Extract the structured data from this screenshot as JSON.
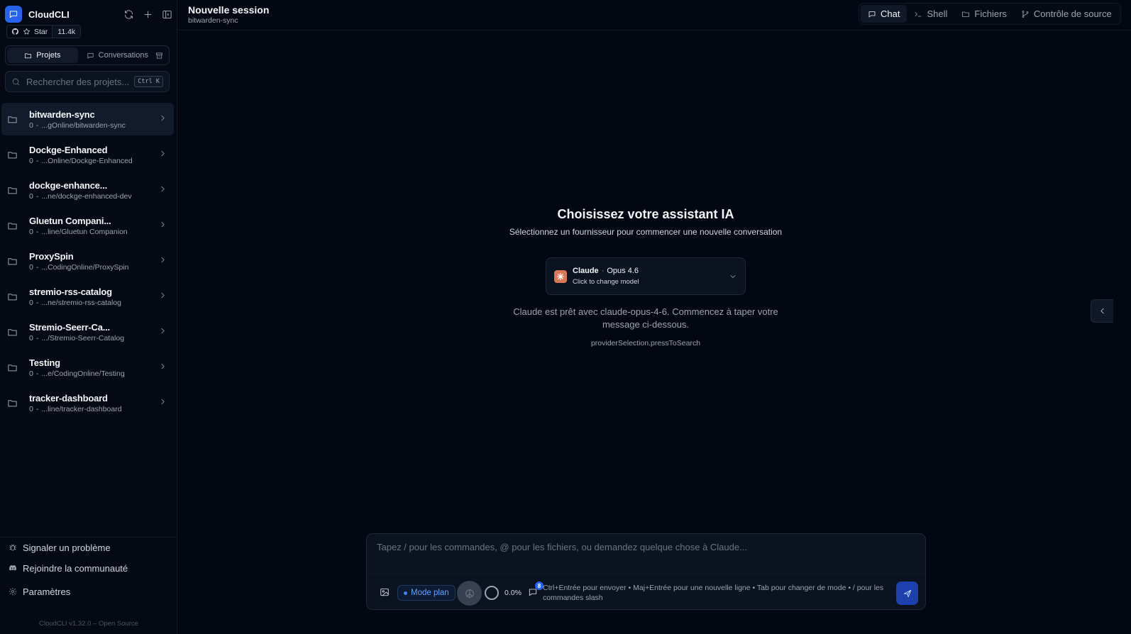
{
  "app": {
    "name": "CloudCLI",
    "version": "CloudCLI v1.32.0 – Open Source"
  },
  "github": {
    "star_label": "Star",
    "star_count": "11.4k"
  },
  "sidebar": {
    "tabs": [
      {
        "label": "Projets"
      },
      {
        "label": "Conversations"
      }
    ],
    "search": {
      "placeholder": "Rechercher des projets...",
      "shortcut": "Ctrl K"
    },
    "projects": [
      {
        "name": "bitwarden-sync",
        "count": "0",
        "path": "...gOnline/bitwarden-sync",
        "active": true
      },
      {
        "name": "Dockge-Enhanced",
        "count": "0",
        "path": "...Online/Dockge-Enhanced"
      },
      {
        "name": "dockge-enhance...",
        "count": "0",
        "path": "...ne/dockge-enhanced-dev"
      },
      {
        "name": "Gluetun Compani...",
        "count": "0",
        "path": "...line/Gluetun Companion"
      },
      {
        "name": "ProxySpin",
        "count": "0",
        "path": "...CodingOnline/ProxySpin"
      },
      {
        "name": "stremio-rss-catalog",
        "count": "0",
        "path": "...ne/stremio-rss-catalog"
      },
      {
        "name": "Stremio-Seerr-Ca...",
        "count": "0",
        "path": ".../Stremio-Seerr-Catalog"
      },
      {
        "name": "Testing",
        "count": "0",
        "path": "...e/CodingOnline/Testing"
      },
      {
        "name": "tracker-dashboard",
        "count": "0",
        "path": "...line/tracker-dashboard"
      }
    ],
    "footer": {
      "report": "Signaler un problème",
      "community": "Rejoindre la communauté",
      "settings": "Paramètres"
    }
  },
  "header": {
    "title": "Nouvelle session",
    "subtitle": "bitwarden-sync",
    "tabs": [
      {
        "label": "Chat",
        "icon": "message-icon"
      },
      {
        "label": "Shell",
        "icon": "terminal-icon"
      },
      {
        "label": "Fichiers",
        "icon": "folder-icon"
      },
      {
        "label": "Contrôle de source",
        "icon": "git-branch-icon"
      }
    ]
  },
  "main": {
    "title": "Choisissez votre assistant IA",
    "subtitle": "Sélectionnez un fournisseur pour commencer une nouvelle conversation",
    "model_card": {
      "provider": "Claude",
      "separator": "·",
      "model": "Opus 4.6",
      "hint": "Click to change model"
    },
    "ready_message": "Claude est prêt avec claude-opus-4-6. Commencez à taper votre message ci-dessous.",
    "press_search": "providerSelection.pressToSearch"
  },
  "composer": {
    "placeholder": "Tapez / pour les commandes, @ pour les fichiers, ou demandez quelque chose à Claude...",
    "mode_label": "Mode plan",
    "context_percent": "0.0%",
    "commands_count": "8",
    "hint": "Ctrl+Entrée pour envoyer • Maj+Entrée pour une nouvelle ligne • Tab pour changer de mode • / pour les commandes slash"
  },
  "colors": {
    "accent": "#2563eb",
    "background": "#030712",
    "claude": "#d97757"
  }
}
